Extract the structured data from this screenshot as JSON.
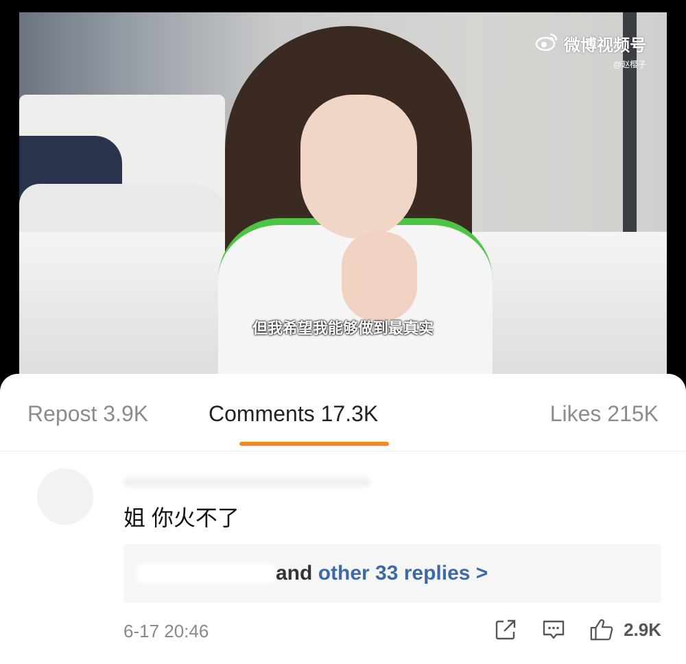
{
  "video": {
    "subtitle": "但我希望我能够做到最真实",
    "watermark": {
      "brand": "微博视频号",
      "handle": "@赵樱子"
    }
  },
  "tabs": [
    {
      "label": "Repost 3.9K",
      "active": false
    },
    {
      "label": "Comments 17.3K",
      "active": true
    },
    {
      "label": "Likes 215K",
      "active": false
    }
  ],
  "comment": {
    "text": "姐 你火不了",
    "replies_prefix": "and",
    "replies_link": "other 33 replies >",
    "timestamp": "6-17 20:46",
    "likes": "2.9K"
  },
  "icons": [
    "weibo-logo-icon",
    "share-icon",
    "comment-icon",
    "like-icon"
  ],
  "colors": {
    "accent": "#f08a24",
    "link": "#3b6aa6"
  }
}
